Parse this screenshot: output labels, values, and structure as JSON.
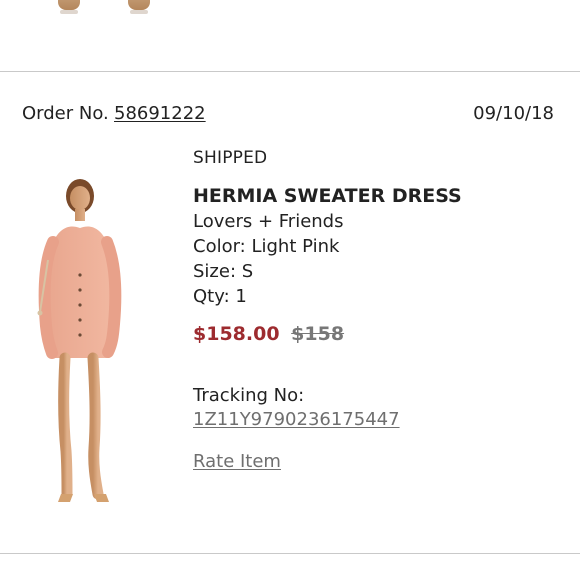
{
  "order": {
    "label": "Order No.",
    "number": "58691222",
    "date": "09/10/18"
  },
  "item": {
    "status": "SHIPPED",
    "name": "HERMIA SWEATER DRESS",
    "brand": "Lovers + Friends",
    "color": "Color: Light Pink",
    "size": "Size: S",
    "qty": "Qty: 1",
    "sale_price": "$158.00",
    "original_price": "$158",
    "tracking_label": "Tracking No:",
    "tracking_number": "1Z11Y9790236175447",
    "rate_item": "Rate Item"
  },
  "colors": {
    "sale_price": "#9d2b2f",
    "muted_link": "#6f6f6f",
    "divider": "#c9c9c9"
  },
  "icons": {
    "top_item_left": "shoe-preview-icon",
    "top_item_right": "shoe-preview-icon"
  }
}
